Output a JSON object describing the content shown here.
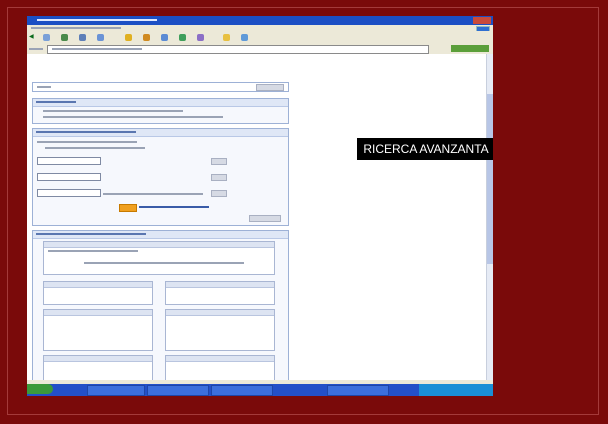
{
  "caption": "RICERCA AVANZANTA",
  "colors": {
    "slide_background": "#7a0a0a",
    "titlebar": "#1b4fc4",
    "taskbar": "#2350c8",
    "search_button": "#f0a020"
  },
  "icons": [
    "back-arrow-icon",
    "ie-logo-icon",
    "start-icon"
  ]
}
